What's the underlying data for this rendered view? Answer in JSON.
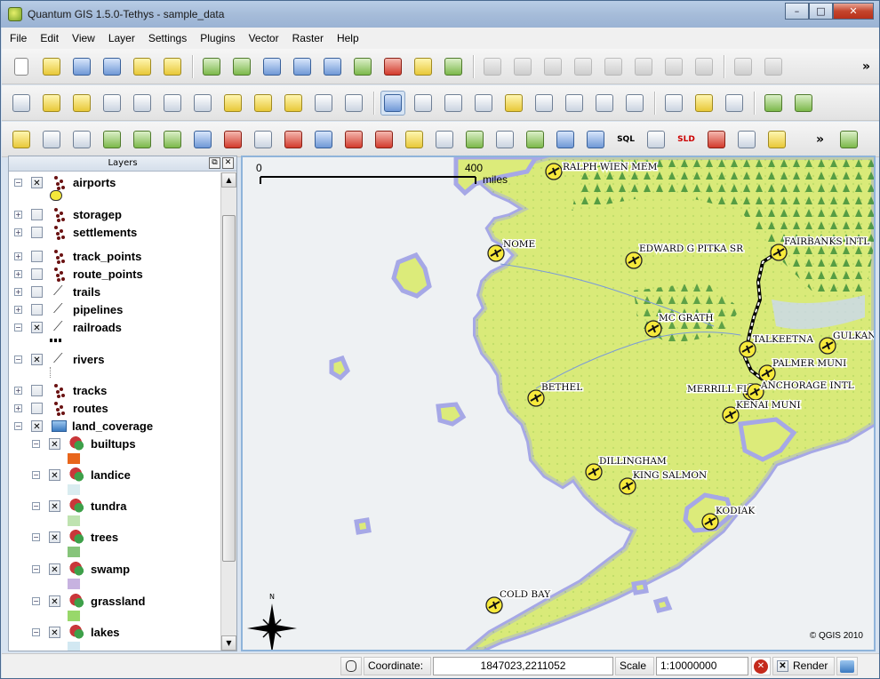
{
  "window": {
    "title": "Quantum GIS 1.5.0-Tethys - sample_data"
  },
  "window_buttons": {
    "minimize": "–",
    "maximize": "□",
    "close": "✕"
  },
  "menu": [
    "File",
    "Edit",
    "View",
    "Layer",
    "Settings",
    "Plugins",
    "Vector",
    "Raster",
    "Help"
  ],
  "toolbar_overflow": "»",
  "toolbar3_text": {
    "sql": "SQL",
    "sld": "SLD"
  },
  "layers_panel": {
    "title": "Layers",
    "float_button": "⧉",
    "close_button": "✕",
    "layers": [
      {
        "name": "airports",
        "checked": true,
        "expanded": true,
        "kind": "points"
      },
      {
        "name": "storagep",
        "checked": false,
        "expanded": false,
        "kind": "points"
      },
      {
        "name": "settlements",
        "checked": false,
        "expanded": false,
        "kind": "points"
      },
      {
        "name": "track_points",
        "checked": false,
        "expanded": false,
        "kind": "points"
      },
      {
        "name": "route_points",
        "checked": false,
        "expanded": false,
        "kind": "points"
      },
      {
        "name": "trails",
        "checked": false,
        "expanded": false,
        "kind": "lines"
      },
      {
        "name": "pipelines",
        "checked": false,
        "expanded": false,
        "kind": "lines"
      },
      {
        "name": "railroads",
        "checked": true,
        "expanded": true,
        "kind": "lines"
      },
      {
        "name": "rivers",
        "checked": true,
        "expanded": true,
        "kind": "lines"
      },
      {
        "name": "tracks",
        "checked": false,
        "expanded": false,
        "kind": "points"
      },
      {
        "name": "routes",
        "checked": false,
        "expanded": false,
        "kind": "points"
      },
      {
        "name": "land_coverage",
        "checked": true,
        "expanded": true,
        "kind": "group"
      },
      {
        "name": "builtups",
        "checked": true,
        "expanded": true,
        "kind": "poly",
        "swatch": "#e8661c"
      },
      {
        "name": "landice",
        "checked": true,
        "expanded": true,
        "kind": "poly",
        "swatch": "#d9ecf0"
      },
      {
        "name": "tundra",
        "checked": true,
        "expanded": true,
        "kind": "poly",
        "swatch": "#bfe3b0"
      },
      {
        "name": "trees",
        "checked": true,
        "expanded": true,
        "kind": "poly",
        "swatch": "#86c47a"
      },
      {
        "name": "swamp",
        "checked": true,
        "expanded": true,
        "kind": "poly",
        "swatch": "#c7b2e0"
      },
      {
        "name": "grassland",
        "checked": true,
        "expanded": true,
        "kind": "poly",
        "swatch": "#98d86a"
      },
      {
        "name": "lakes",
        "checked": true,
        "expanded": true,
        "kind": "poly",
        "swatch": "#d2e8f2"
      }
    ]
  },
  "map": {
    "scale_bar": {
      "start": "0",
      "end": "400",
      "unit": "miles"
    },
    "north_label": "N",
    "copyright": "© QGIS 2010",
    "airports": [
      "RALPH WIEN MEM",
      "NOME",
      "EDWARD G PITKA SR",
      "FAIRBANKS INTL",
      "MC GRATH",
      "TALKEETNA",
      "GULKANA",
      "PALMER MUNI",
      "MERRILL FLD",
      "ANCHORAGE INTL",
      "KENAI MUNI",
      "BETHEL",
      "DILLINGHAM",
      "KING SALMON",
      "KODIAK",
      "COLD BAY"
    ],
    "colors": {
      "sea": "#eef1f3",
      "land": "#dceb7a",
      "coast_halo": "#a6a8e6",
      "trees": "#3f8f3a",
      "grass": "#b8df6a"
    }
  },
  "status": {
    "coordinate_label": "Coordinate:",
    "coordinate_value": "1847023,2211052",
    "scale_label": "Scale",
    "scale_value": "1:10000000",
    "render_label": "Render",
    "render_checked": true
  }
}
